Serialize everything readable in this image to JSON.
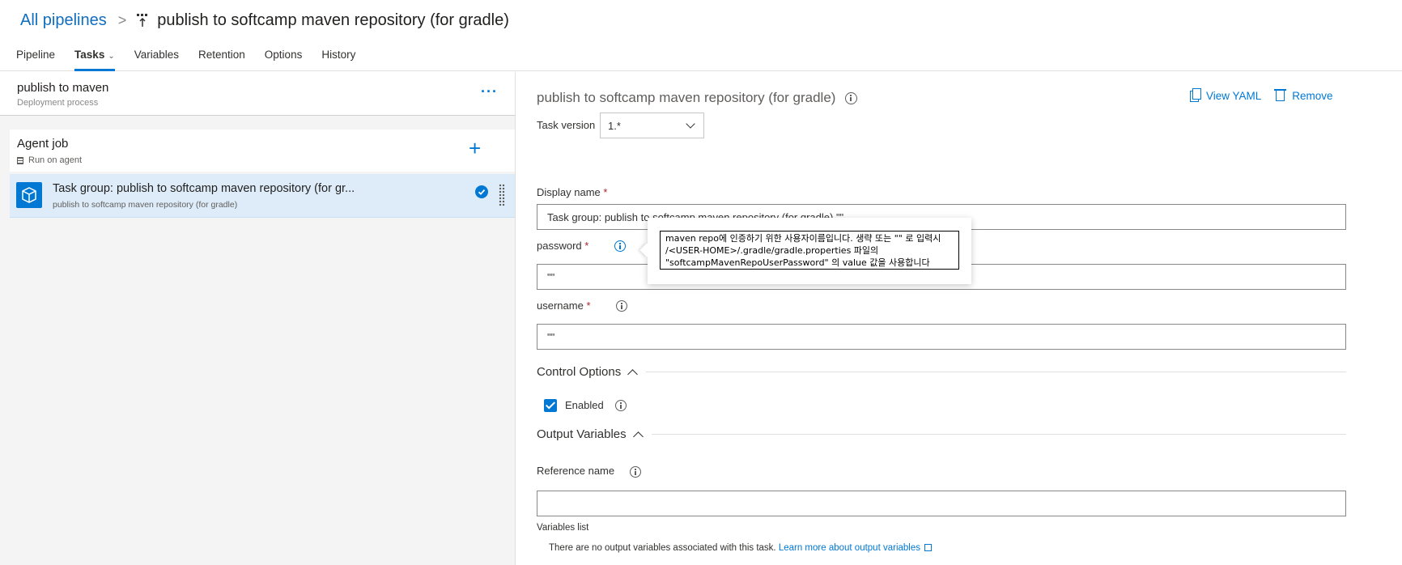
{
  "breadcrumb": {
    "root": "All pipelines",
    "separator": ">",
    "title": "publish to softcamp maven repository (for gradle)"
  },
  "tabs": [
    "Pipeline",
    "Tasks",
    "Variables",
    "Retention",
    "Options",
    "History"
  ],
  "active_tab": "Tasks",
  "left_panel": {
    "process": {
      "title": "publish to maven",
      "subtitle": "Deployment process",
      "more": "···"
    },
    "agent_job": {
      "title": "Agent job",
      "subtitle": "Run on agent",
      "add": "+"
    },
    "task": {
      "title": "Task group: publish to softcamp maven repository (for gr...",
      "subtitle": "publish to softcamp maven repository (for gradle)"
    }
  },
  "right_panel": {
    "title": "publish to softcamp maven repository (for gradle)",
    "view_yaml": "View YAML",
    "remove": "Remove",
    "task_version_label": "Task version",
    "task_version_value": "1.*",
    "display_name_label": "Display name",
    "display_name_value": "Task group: publish to softcamp maven repository (for gradle) \"\"",
    "password_label": "password",
    "password_value": "\"\"",
    "username_label": "username",
    "username_value": "\"\"",
    "required_mark": "*",
    "control_options": "Control Options",
    "enabled_label": "Enabled",
    "output_variables": "Output Variables",
    "reference_name_label": "Reference name",
    "reference_name_value": "",
    "variables_list_label": "Variables list",
    "no_output_text": "There are no output variables associated with this task.",
    "learn_more": "Learn more about output variables"
  },
  "tooltip": {
    "text": "maven repo에 인증하기 위한 사용자이름입니다. 생략 또는 \"\" 로 입력시 /<USER-HOME>/.gradle/gradle.properties 파일의 \"softcampMavenRepoUserPassword\" 의 value 값을 사용합니다"
  },
  "colors": {
    "accent": "#0078d4",
    "selected_row": "#deecf9"
  }
}
